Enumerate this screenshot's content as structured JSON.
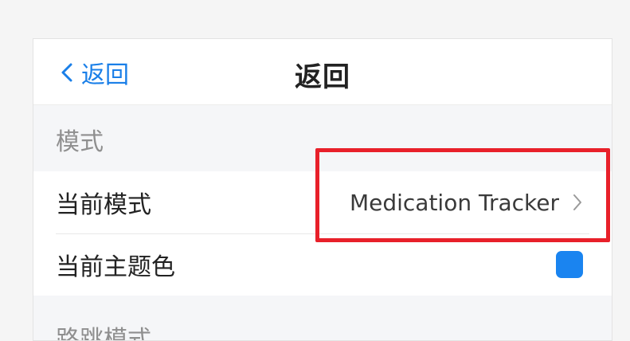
{
  "navbar": {
    "back_label": "返回",
    "title": "返回"
  },
  "sections": [
    {
      "header": "模式",
      "rows": [
        {
          "label": "当前模式",
          "value": "Medication Tracker"
        },
        {
          "label": "当前主题色",
          "swatch_color": "#1a84f0"
        }
      ]
    },
    {
      "header": "路跳模式"
    }
  ],
  "colors": {
    "accent": "#1a7fe8",
    "highlight": "#e8202a"
  }
}
